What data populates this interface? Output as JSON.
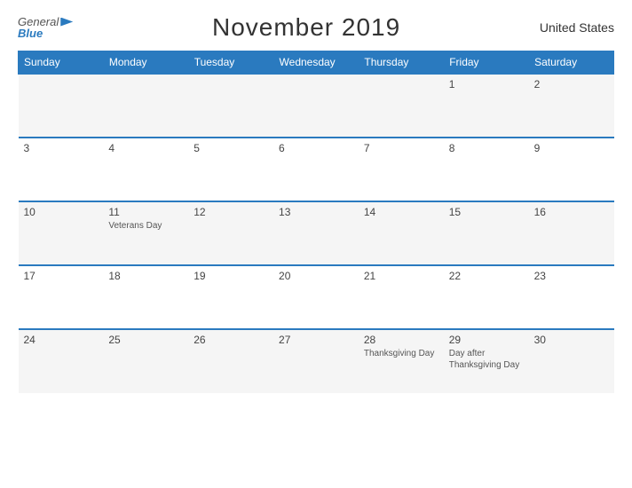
{
  "header": {
    "logo_general": "General",
    "logo_blue": "Blue",
    "title": "November 2019",
    "country": "United States"
  },
  "weekdays": [
    "Sunday",
    "Monday",
    "Tuesday",
    "Wednesday",
    "Thursday",
    "Friday",
    "Saturday"
  ],
  "rows": [
    [
      {
        "num": "",
        "holiday": ""
      },
      {
        "num": "",
        "holiday": ""
      },
      {
        "num": "",
        "holiday": ""
      },
      {
        "num": "",
        "holiday": ""
      },
      {
        "num": "",
        "holiday": ""
      },
      {
        "num": "1",
        "holiday": ""
      },
      {
        "num": "2",
        "holiday": ""
      }
    ],
    [
      {
        "num": "3",
        "holiday": ""
      },
      {
        "num": "4",
        "holiday": ""
      },
      {
        "num": "5",
        "holiday": ""
      },
      {
        "num": "6",
        "holiday": ""
      },
      {
        "num": "7",
        "holiday": ""
      },
      {
        "num": "8",
        "holiday": ""
      },
      {
        "num": "9",
        "holiday": ""
      }
    ],
    [
      {
        "num": "10",
        "holiday": ""
      },
      {
        "num": "11",
        "holiday": "Veterans Day"
      },
      {
        "num": "12",
        "holiday": ""
      },
      {
        "num": "13",
        "holiday": ""
      },
      {
        "num": "14",
        "holiday": ""
      },
      {
        "num": "15",
        "holiday": ""
      },
      {
        "num": "16",
        "holiday": ""
      }
    ],
    [
      {
        "num": "17",
        "holiday": ""
      },
      {
        "num": "18",
        "holiday": ""
      },
      {
        "num": "19",
        "holiday": ""
      },
      {
        "num": "20",
        "holiday": ""
      },
      {
        "num": "21",
        "holiday": ""
      },
      {
        "num": "22",
        "holiday": ""
      },
      {
        "num": "23",
        "holiday": ""
      }
    ],
    [
      {
        "num": "24",
        "holiday": ""
      },
      {
        "num": "25",
        "holiday": ""
      },
      {
        "num": "26",
        "holiday": ""
      },
      {
        "num": "27",
        "holiday": ""
      },
      {
        "num": "28",
        "holiday": "Thanksgiving Day"
      },
      {
        "num": "29",
        "holiday": "Day after\nThanksgiving Day"
      },
      {
        "num": "30",
        "holiday": ""
      }
    ]
  ]
}
